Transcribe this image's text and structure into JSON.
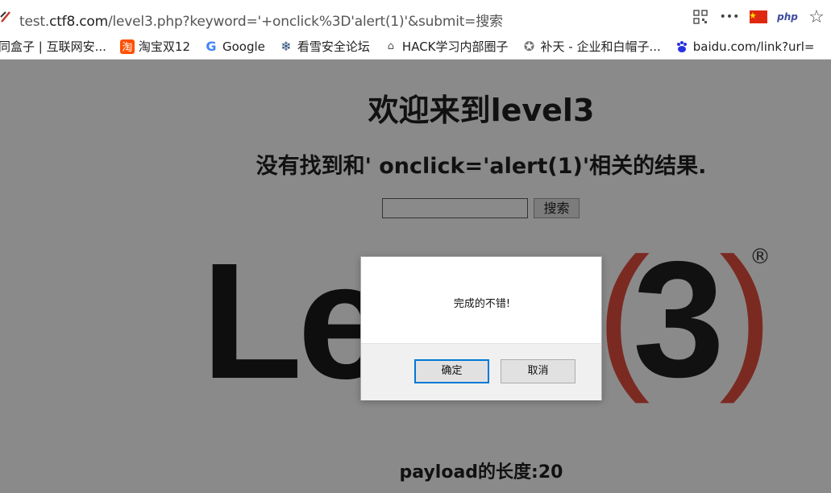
{
  "browser": {
    "url_prefix": "test.",
    "url_host": "ctf8.com",
    "url_rest": "/level3.php?keyword='+onclick%3D'alert(1)'&submit=搜索",
    "icons": [
      "qr-code-icon",
      "more-icon",
      "china-flag-icon",
      "php-icon",
      "star-icon"
    ],
    "php_label": "php",
    "more_label": "•••",
    "star_label": "☆"
  },
  "bookmarks": [
    {
      "icon": "partial-icon",
      "label": "同盒子 | 互联网安..."
    },
    {
      "icon": "taobao-icon",
      "icon_text": "淘",
      "label": "淘宝双12"
    },
    {
      "icon": "google-icon",
      "icon_text": "G",
      "label": "Google"
    },
    {
      "icon": "snowflake-icon",
      "icon_text": "❄",
      "label": "看雪安全论坛"
    },
    {
      "icon": "hack-icon",
      "icon_text": "⌂",
      "label": "HACK学习内部圈子"
    },
    {
      "icon": "butian-icon",
      "icon_text": "✪",
      "label": "补天 - 企业和白帽子..."
    },
    {
      "icon": "baidu-icon",
      "icon_text": "🐾",
      "label": "baidu.com/link?url="
    }
  ],
  "page": {
    "title": "欢迎来到level3",
    "subtitle": "没有找到和' onclick='alert(1)'相关的结果.",
    "search_value": "",
    "search_button": "搜索",
    "logo_text": "Le",
    "logo_open_paren": "(",
    "logo_three": "3",
    "logo_close_paren": ")",
    "logo_registered": "®",
    "payload_length": "payload的长度:20"
  },
  "dialog": {
    "message": "完成的不错!",
    "ok_label": "确定",
    "cancel_label": "取消"
  }
}
